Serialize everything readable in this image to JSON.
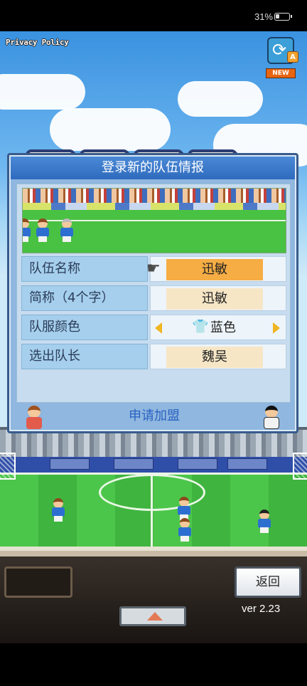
{
  "status_bar": {
    "battery_percent": "31%"
  },
  "header": {
    "privacy_link": "Privacy Policy",
    "new_badge": "NEW",
    "badge_letter": "A"
  },
  "dialog": {
    "title": "登录新的队伍情报",
    "rows": [
      {
        "label": "队伍名称",
        "value": "迅敏"
      },
      {
        "label": "简称（4个字）",
        "value": "迅敏"
      },
      {
        "label": "队服颜色",
        "value": "蓝色"
      },
      {
        "label": "选出队长",
        "value": "魏吴"
      }
    ],
    "apply_label": "申请加盟"
  },
  "footer": {
    "back_label": "返回",
    "version": "ver 2.23"
  },
  "colors": {
    "accent": "#f6ad44",
    "title_bar": "#2f6bbe",
    "label_bg": "#a5cfec",
    "jersey": "#1d5ec8"
  },
  "icons": {
    "hand": "pointing-hand-icon",
    "shirt": "shirt-icon",
    "left": "triangle-left-icon",
    "right": "triangle-right-icon"
  }
}
